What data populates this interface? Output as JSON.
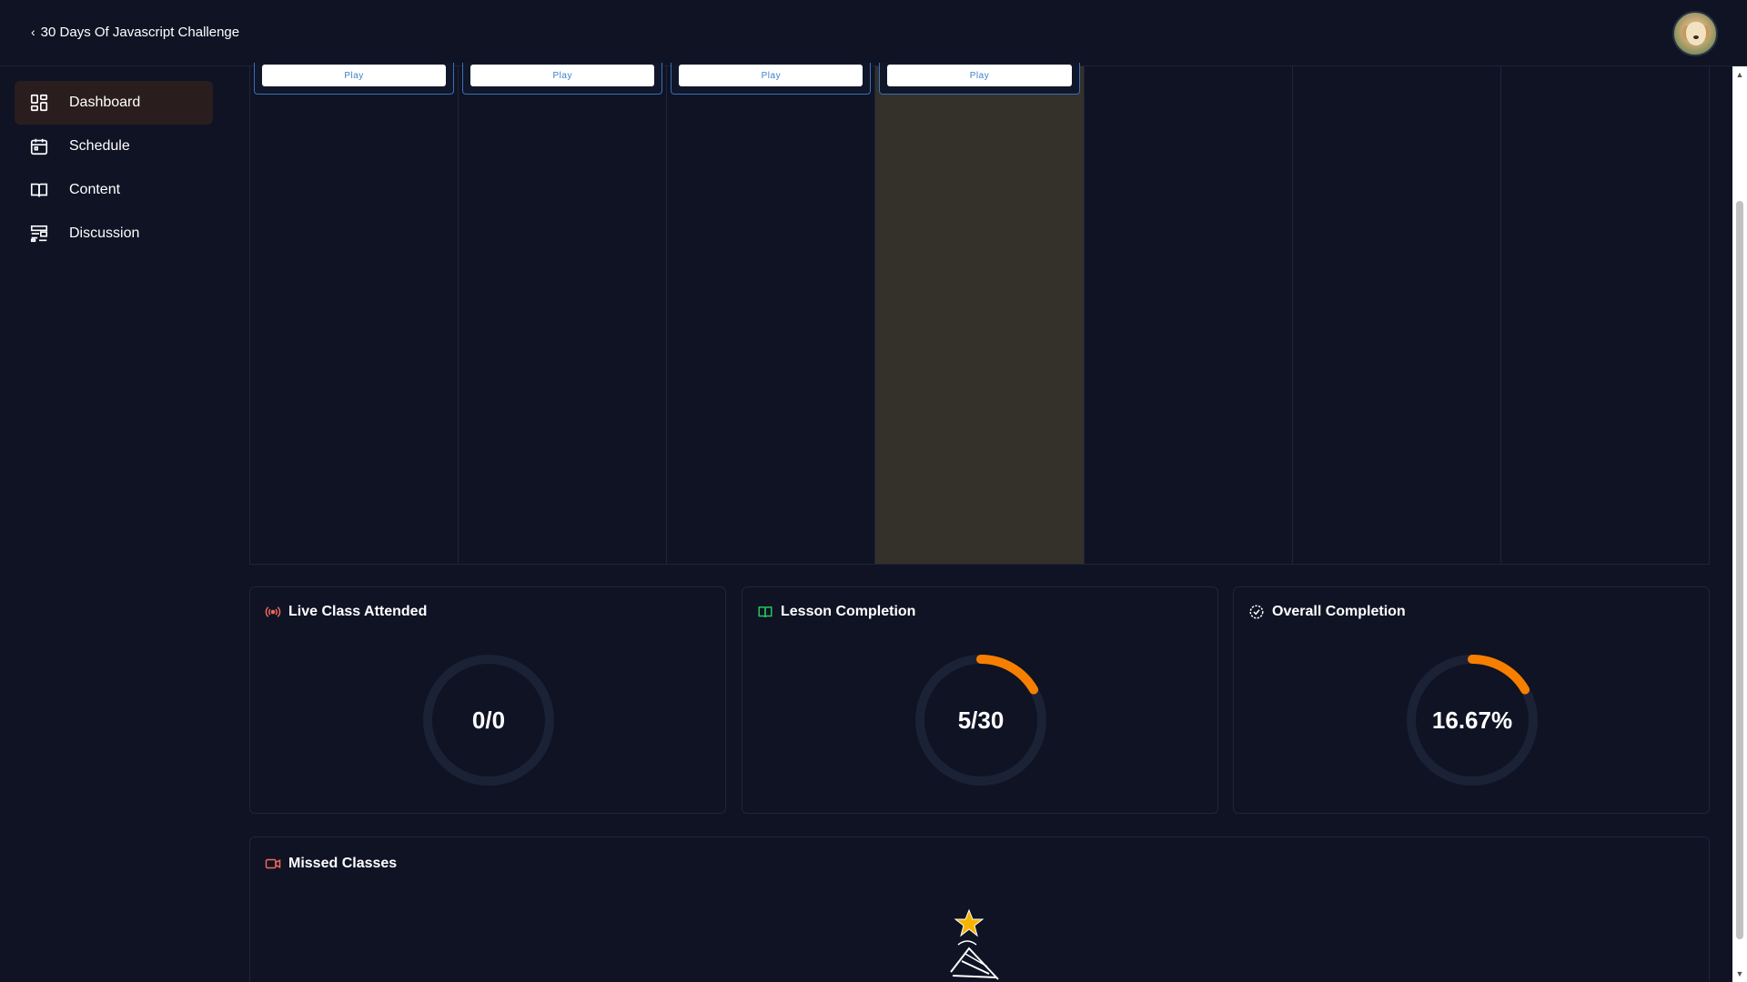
{
  "header": {
    "back_chevron": "‹",
    "back_label": "30 Days Of Javascript Challenge",
    "avatar_icon": "dog-avatar-icon"
  },
  "sidebar": {
    "items": [
      {
        "label": "Dashboard",
        "icon": "dashboard-icon",
        "active": true
      },
      {
        "label": "Schedule",
        "icon": "calendar-icon",
        "active": false
      },
      {
        "label": "Content",
        "icon": "book-icon",
        "active": false
      },
      {
        "label": "Discussion",
        "icon": "discussion-icon",
        "active": false
      }
    ]
  },
  "calendar": {
    "play_label": "Play",
    "columns": 7,
    "events_in_columns": [
      0,
      1,
      2,
      3
    ],
    "highlighted_column": 3
  },
  "stats": {
    "live": {
      "title": "Live Class Attended",
      "value_text": "0/0",
      "progress": 0,
      "icon": "broadcast-icon"
    },
    "lesson": {
      "title": "Lesson Completion",
      "value_text": "5/30",
      "progress": 0.1667,
      "icon": "open-book-icon"
    },
    "overall": {
      "title": "Overall Completion",
      "value_text": "16.67%",
      "progress": 0.1667,
      "icon": "check-badge-icon"
    }
  },
  "missed": {
    "title": "Missed Classes",
    "icon": "video-camera-icon",
    "illustration": "shooting-star-illustration"
  },
  "colors": {
    "background": "#0f1324",
    "active_nav": "#2a1d1e",
    "today_column": "#34302a",
    "accent_orange": "#f77f00",
    "ring_track": "#1c2236",
    "event_border": "#3b6fb3",
    "play_text": "#3b82c8"
  }
}
